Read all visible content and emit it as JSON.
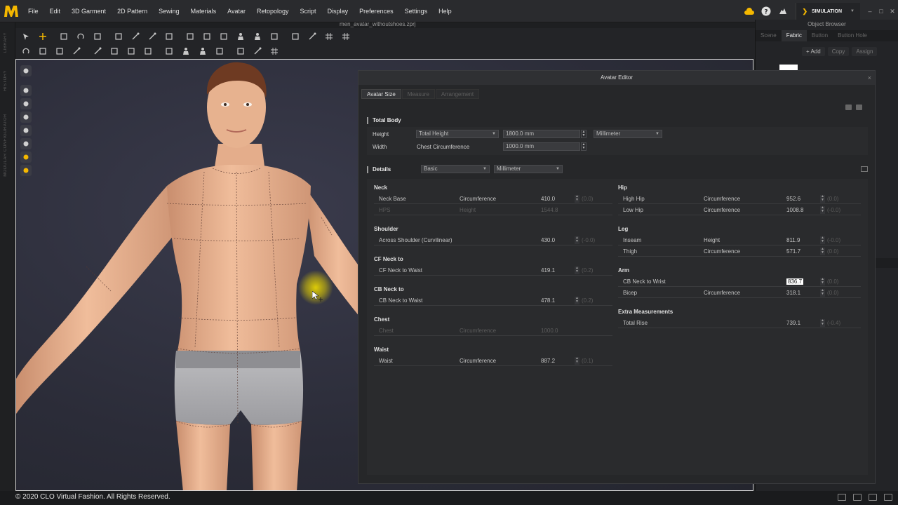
{
  "app": {
    "logo_letter": "M",
    "menus": [
      "File",
      "Edit",
      "3D Garment",
      "2D Pattern",
      "Sewing",
      "Materials",
      "Avatar",
      "Retopology",
      "Script",
      "Display",
      "Preferences",
      "Settings",
      "Help"
    ],
    "mode_label": "SIMULATION",
    "file_title": "men_avatar_withoutshoes.zprj"
  },
  "left_strip": {
    "labels": [
      "LIBRARY",
      "HISTORY",
      "MODULAR CONFIGURATOR"
    ]
  },
  "object_browser": {
    "title": "Object Browser",
    "tabs": [
      "Scene",
      "Fabric",
      "Button",
      "Button Hole"
    ],
    "active_tab": "Fabric",
    "add_label": "+ Add",
    "copy_label": "Copy",
    "assign_label": "Assign"
  },
  "avatar_editor": {
    "title": "Avatar Editor",
    "tabs": [
      "Avatar Size",
      "Measure",
      "Arrangement"
    ],
    "total_body": {
      "heading": "Total Body",
      "height_label": "Height",
      "height_select": "Total Height",
      "height_value": "1800.0 mm",
      "unit_select": "Millimeter",
      "width_label": "Width",
      "width_kind": "Chest Circumference",
      "width_value": "1000.0 mm"
    },
    "details": {
      "heading": "Details",
      "mode_select": "Basic",
      "unit_select": "Millimeter"
    },
    "left_groups": [
      {
        "title": "Neck",
        "rows": [
          {
            "name": "Neck Base",
            "kind": "Circumference",
            "value": "410.0",
            "diff": "(0.0)",
            "disabled": false
          },
          {
            "name": "HPS",
            "kind": "Height",
            "value": "1544.8",
            "diff": "",
            "disabled": true
          }
        ]
      },
      {
        "title": "Shoulder",
        "rows": [
          {
            "name": "Across Shoulder (Curvilinear)",
            "kind": "",
            "value": "430.0",
            "diff": "(-0.0)",
            "disabled": false
          }
        ]
      },
      {
        "title": "CF Neck to",
        "rows": [
          {
            "name": "CF Neck to Waist",
            "kind": "",
            "value": "419.1",
            "diff": "(0.2)",
            "disabled": false
          }
        ]
      },
      {
        "title": "CB Neck to",
        "rows": [
          {
            "name": "CB Neck to Waist",
            "kind": "",
            "value": "478.1",
            "diff": "(0.2)",
            "disabled": false
          }
        ]
      },
      {
        "title": "Chest",
        "rows": [
          {
            "name": "Chest",
            "kind": "Circumference",
            "value": "1000.0",
            "diff": "",
            "disabled": true
          }
        ]
      },
      {
        "title": "Waist",
        "rows": [
          {
            "name": "Waist",
            "kind": "Circumference",
            "value": "887.2",
            "diff": "(0.1)",
            "disabled": false
          }
        ]
      }
    ],
    "right_groups": [
      {
        "title": "Hip",
        "rows": [
          {
            "name": "High Hip",
            "kind": "Circumference",
            "value": "952.6",
            "diff": "(0.0)",
            "disabled": false
          },
          {
            "name": "Low Hip",
            "kind": "Circumference",
            "value": "1008.8",
            "diff": "(-0.0)",
            "disabled": false
          }
        ]
      },
      {
        "title": "Leg",
        "rows": [
          {
            "name": "Inseam",
            "kind": "Height",
            "value": "811.9",
            "diff": "(-0.0)",
            "disabled": false
          },
          {
            "name": "Thigh",
            "kind": "Circumference",
            "value": "571.7",
            "diff": "(0.0)",
            "disabled": false
          }
        ]
      },
      {
        "title": "Arm",
        "rows": [
          {
            "name": "CB Neck to Wrist",
            "kind": "",
            "value": "836.7",
            "diff": "(0.0)",
            "disabled": false,
            "highlight": true
          },
          {
            "name": "Bicep",
            "kind": "Circumference",
            "value": "318.1",
            "diff": "(0.0)",
            "disabled": false
          }
        ]
      },
      {
        "title": "Extra Measurements",
        "rows": [
          {
            "name": "Total Rise",
            "kind": "",
            "value": "739.1",
            "diff": "(-0.4)",
            "disabled": false
          }
        ]
      }
    ]
  },
  "status": {
    "copyright": "© 2020 CLO Virtual Fashion. All Rights Reserved."
  },
  "colors": {
    "accent": "#f5b800",
    "skin": "#e8b08e",
    "underwear": "#a8a8aa"
  }
}
